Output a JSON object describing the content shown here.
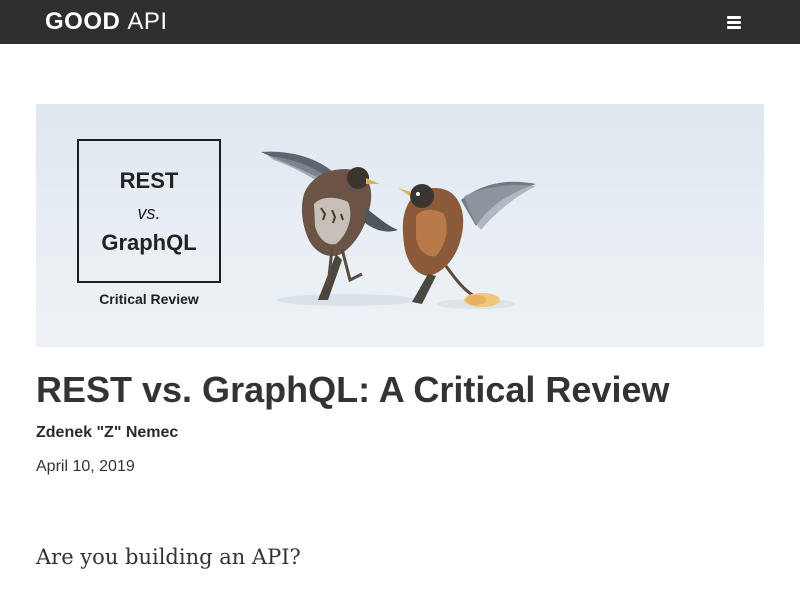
{
  "header": {
    "logo_bold": "GOOD",
    "logo_light": "API",
    "menu_icon": "hamburger-menu-icon"
  },
  "hero": {
    "box_line1": "REST",
    "box_line2": "vs.",
    "box_line3": "GraphQL",
    "caption": "Critical Review",
    "image_subject": "two birds fighting in snow"
  },
  "article": {
    "title": "REST vs. GraphQL: A Critical Review",
    "author": "Zdenek \"Z\" Nemec",
    "date": "April 10, 2019",
    "lead": "Are you building an API?"
  }
}
